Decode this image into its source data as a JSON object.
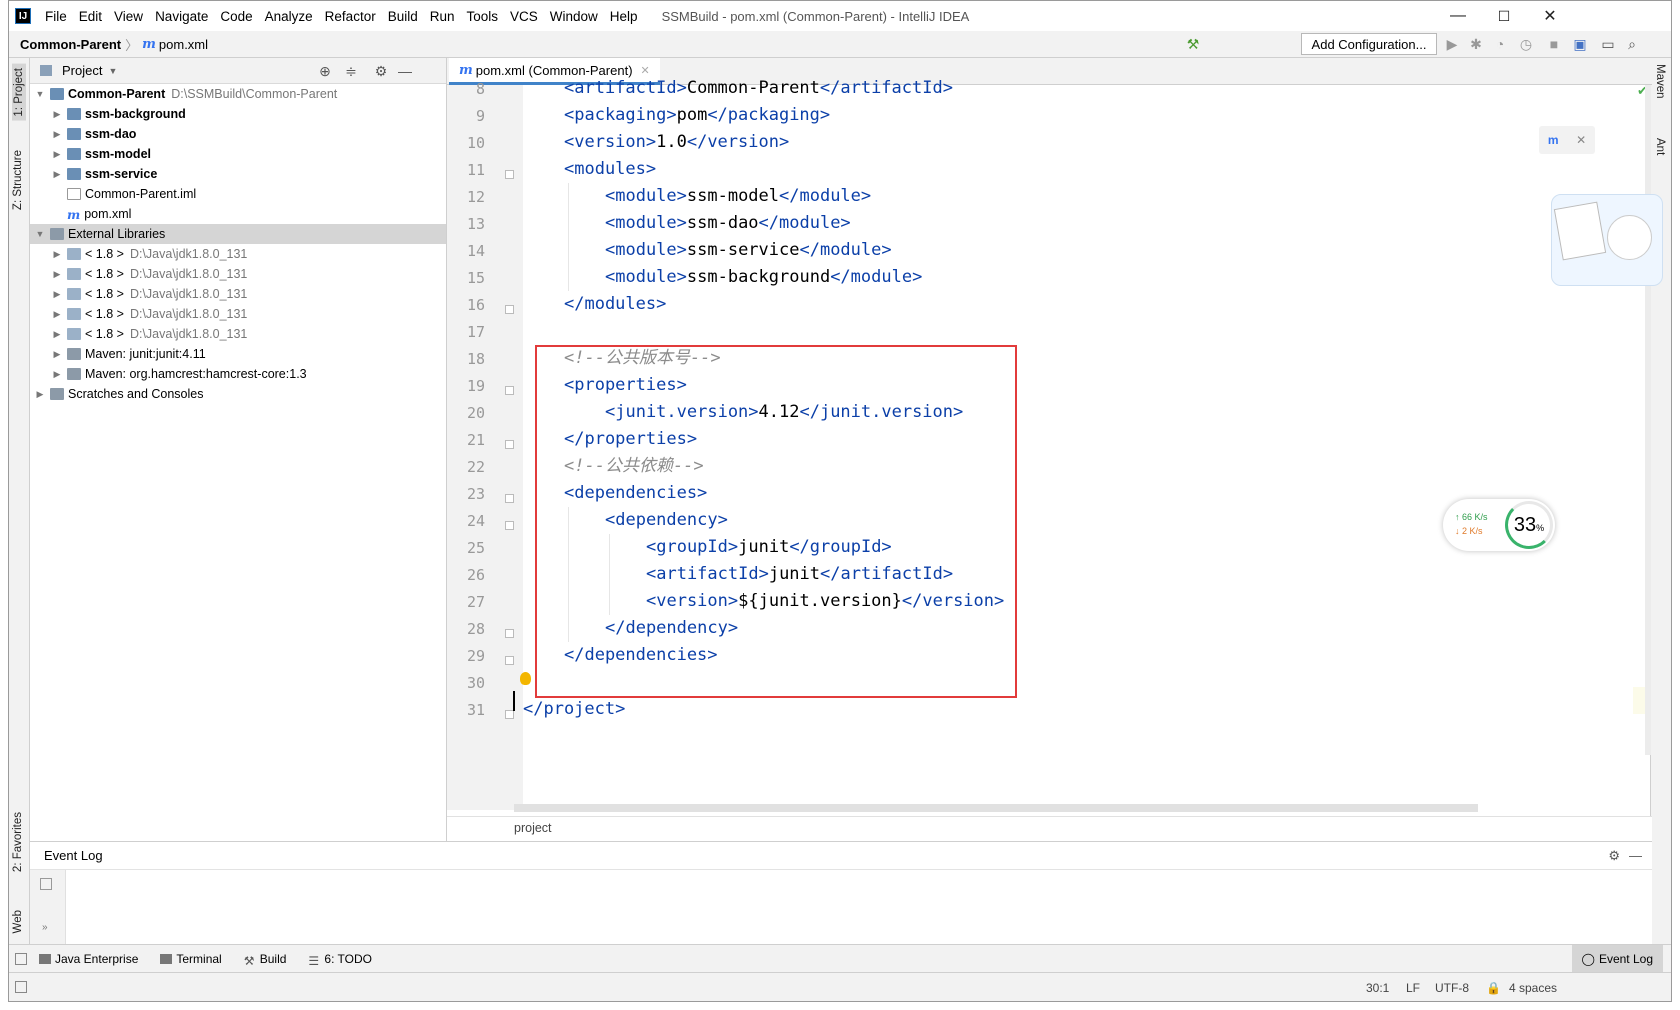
{
  "titlebar": {
    "menus": [
      "File",
      "Edit",
      "View",
      "Navigate",
      "Code",
      "Analyze",
      "Refactor",
      "Build",
      "Run",
      "Tools",
      "VCS",
      "Window",
      "Help"
    ],
    "title": "SSMBuild - pom.xml (Common-Parent) - IntelliJ IDEA",
    "minimize": "—",
    "maximize": "☐",
    "close": "✕"
  },
  "navbar": {
    "project": "Common-Parent",
    "file": "pom.xml",
    "add_config": "Add Configuration..."
  },
  "left_strip": {
    "project": "1: Project",
    "structure": "Z: Structure",
    "favorites": "2: Favorites",
    "web": "Web"
  },
  "right_strip": {
    "maven": "Maven",
    "ant": "Ant"
  },
  "project_panel": {
    "title": "Project",
    "tree": [
      {
        "label": "Common-Parent",
        "path": "D:\\SSMBuild\\Common-Parent",
        "bold": true,
        "indent": 0,
        "icon": "module-folder-icon",
        "arrow": "▼"
      },
      {
        "label": "ssm-background",
        "path": "",
        "bold": true,
        "indent": 1,
        "icon": "module-folder-icon",
        "arrow": "▶"
      },
      {
        "label": "ssm-dao",
        "path": "",
        "bold": true,
        "indent": 1,
        "icon": "module-folder-icon",
        "arrow": "▶"
      },
      {
        "label": "ssm-model",
        "path": "",
        "bold": true,
        "indent": 1,
        "icon": "module-folder-icon",
        "arrow": "▶"
      },
      {
        "label": "ssm-service",
        "path": "",
        "bold": true,
        "indent": 1,
        "icon": "module-folder-icon",
        "arrow": "▶"
      },
      {
        "label": "Common-Parent.iml",
        "path": "",
        "bold": false,
        "indent": 1,
        "icon": "iml-file-icon",
        "arrow": ""
      },
      {
        "label": "pom.xml",
        "path": "",
        "bold": false,
        "indent": 1,
        "icon": "maven-file-icon",
        "arrow": ""
      },
      {
        "label": "External Libraries",
        "path": "",
        "bold": false,
        "indent": 0,
        "icon": "libraries-icon",
        "arrow": "▼",
        "selected": true
      },
      {
        "label": "< 1.8 >",
        "path": "D:\\Java\\jdk1.8.0_131",
        "bold": false,
        "indent": 1,
        "icon": "jdk-icon",
        "arrow": "▶"
      },
      {
        "label": "< 1.8 >",
        "path": "D:\\Java\\jdk1.8.0_131",
        "bold": false,
        "indent": 1,
        "icon": "jdk-icon",
        "arrow": "▶"
      },
      {
        "label": "< 1.8 >",
        "path": "D:\\Java\\jdk1.8.0_131",
        "bold": false,
        "indent": 1,
        "icon": "jdk-icon",
        "arrow": "▶"
      },
      {
        "label": "< 1.8 >",
        "path": "D:\\Java\\jdk1.8.0_131",
        "bold": false,
        "indent": 1,
        "icon": "jdk-icon",
        "arrow": "▶"
      },
      {
        "label": "< 1.8 >",
        "path": "D:\\Java\\jdk1.8.0_131",
        "bold": false,
        "indent": 1,
        "icon": "jdk-icon",
        "arrow": "▶"
      },
      {
        "label": "Maven: junit:junit:4.11",
        "path": "",
        "bold": false,
        "indent": 1,
        "icon": "library-icon",
        "arrow": "▶"
      },
      {
        "label": "Maven: org.hamcrest:hamcrest-core:1.3",
        "path": "",
        "bold": false,
        "indent": 1,
        "icon": "library-icon",
        "arrow": "▶"
      },
      {
        "label": "Scratches and Consoles",
        "path": "",
        "bold": false,
        "indent": 0,
        "icon": "scratches-icon",
        "arrow": "▶"
      }
    ]
  },
  "editor": {
    "tab": "pom.xml (Common-Parent)",
    "line_numbers": [
      "8",
      "9",
      "10",
      "11",
      "12",
      "13",
      "14",
      "15",
      "16",
      "17",
      "18",
      "19",
      "20",
      "21",
      "22",
      "23",
      "24",
      "25",
      "26",
      "27",
      "28",
      "29",
      "30",
      "31"
    ],
    "lines": [
      {
        "indent": 1,
        "parts": [
          [
            "tag",
            "<artifactId>"
          ],
          [
            "txt",
            "Common-Parent"
          ],
          [
            "tag",
            "</artifactId>"
          ]
        ]
      },
      {
        "indent": 1,
        "parts": [
          [
            "tag",
            "<packaging>"
          ],
          [
            "txt",
            "pom"
          ],
          [
            "tag",
            "</packaging>"
          ]
        ]
      },
      {
        "indent": 1,
        "parts": [
          [
            "tag",
            "<version>"
          ],
          [
            "txt",
            "1.0"
          ],
          [
            "tag",
            "</version>"
          ]
        ]
      },
      {
        "indent": 1,
        "parts": [
          [
            "tag",
            "<modules>"
          ]
        ]
      },
      {
        "indent": 2,
        "parts": [
          [
            "tag",
            "<module>"
          ],
          [
            "txt",
            "ssm-model"
          ],
          [
            "tag",
            "</module>"
          ]
        ]
      },
      {
        "indent": 2,
        "parts": [
          [
            "tag",
            "<module>"
          ],
          [
            "txt",
            "ssm-dao"
          ],
          [
            "tag",
            "</module>"
          ]
        ]
      },
      {
        "indent": 2,
        "parts": [
          [
            "tag",
            "<module>"
          ],
          [
            "txt",
            "ssm-service"
          ],
          [
            "tag",
            "</module>"
          ]
        ]
      },
      {
        "indent": 2,
        "parts": [
          [
            "tag",
            "<module>"
          ],
          [
            "txt",
            "ssm-background"
          ],
          [
            "tag",
            "</module>"
          ]
        ]
      },
      {
        "indent": 1,
        "parts": [
          [
            "tag",
            "</modules>"
          ]
        ]
      },
      {
        "indent": 0,
        "parts": []
      },
      {
        "indent": 1,
        "parts": [
          [
            "cmt",
            "<!--公共版本号-->"
          ]
        ]
      },
      {
        "indent": 1,
        "parts": [
          [
            "tag",
            "<properties>"
          ]
        ]
      },
      {
        "indent": 2,
        "parts": [
          [
            "tag",
            "<junit.version>"
          ],
          [
            "txt",
            "4.12"
          ],
          [
            "tag",
            "</junit.version>"
          ]
        ]
      },
      {
        "indent": 1,
        "parts": [
          [
            "tag",
            "</properties>"
          ]
        ]
      },
      {
        "indent": 1,
        "parts": [
          [
            "cmt",
            "<!--公共依赖-->"
          ]
        ]
      },
      {
        "indent": 1,
        "parts": [
          [
            "tag",
            "<dependencies>"
          ]
        ]
      },
      {
        "indent": 2,
        "parts": [
          [
            "tag",
            "<dependency>"
          ]
        ]
      },
      {
        "indent": 3,
        "parts": [
          [
            "tag",
            "<groupId>"
          ],
          [
            "txt",
            "junit"
          ],
          [
            "tag",
            "</groupId>"
          ]
        ]
      },
      {
        "indent": 3,
        "parts": [
          [
            "tag",
            "<artifactId>"
          ],
          [
            "txt",
            "junit"
          ],
          [
            "tag",
            "</artifactId>"
          ]
        ]
      },
      {
        "indent": 3,
        "parts": [
          [
            "tag",
            "<version>"
          ],
          [
            "txt",
            "${junit.version}"
          ],
          [
            "tag",
            "</version>"
          ]
        ]
      },
      {
        "indent": 2,
        "parts": [
          [
            "tag",
            "</dependency>"
          ]
        ]
      },
      {
        "indent": 1,
        "parts": [
          [
            "tag",
            "</dependencies>"
          ]
        ]
      },
      {
        "indent": 0,
        "parts": []
      },
      {
        "indent": 0,
        "parts": [
          [
            "tag",
            "</project>"
          ]
        ]
      }
    ],
    "breadcrumb": "project"
  },
  "event_log": {
    "title": "Event Log"
  },
  "tool_windows": [
    "Java Enterprise",
    "Terminal",
    "Build",
    "6: TODO"
  ],
  "event_log_button": "Event Log",
  "statusbar": {
    "position": "30:1",
    "line_sep": "LF",
    "encoding": "UTF-8",
    "indent": "4 spaces"
  },
  "net_widget": {
    "up": "↑ 66 K/s",
    "down": "↓ 2 K/s",
    "cpu": "33",
    "unit": "%"
  }
}
